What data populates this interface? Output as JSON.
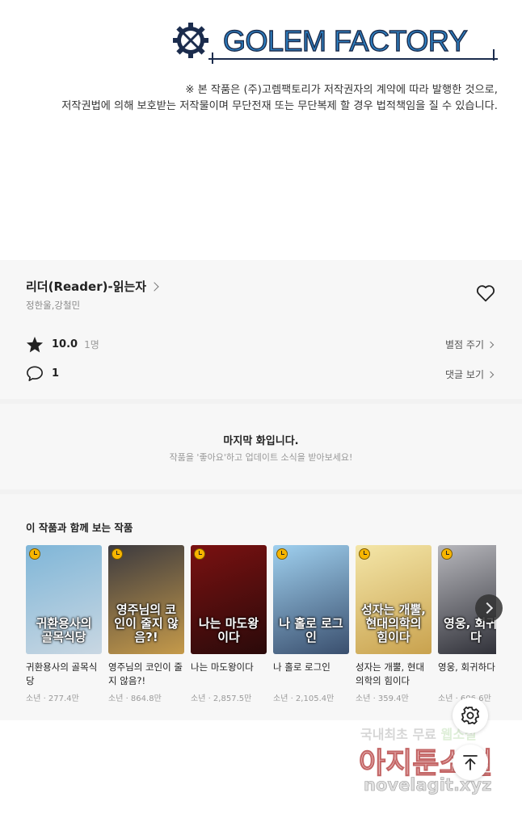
{
  "banner": {
    "logo_text": "GOLEM FACTORY",
    "notice_line1": "※ 본 작품은 (주)고렘팩토리가 저작권자의 계약에 따라 발행한 것으로,",
    "notice_line2": "저작권법에 의해 보호받는 저작물이며 무단전재 또는 무단복제 할 경우 법적책임을 질 수 있습니다."
  },
  "work": {
    "title": "리더(Reader)-읽는자",
    "authors": "정한울,강철민",
    "rating": "10.0",
    "rating_count": "1명",
    "comments": "1",
    "rate_link": "별점 주기",
    "comments_link": "댓글 보기"
  },
  "last_episode": {
    "title": "마지막 화입니다.",
    "subtitle": "작품을 '좋아요'하고 업데이트 소식을 받아보세요!"
  },
  "recommendations": {
    "heading": "이 작품과 함께 보는 작품",
    "items": [
      {
        "name": "귀환용사의 골목식당",
        "meta": "소년 · 277.4만",
        "cover_text": "귀환용사의 골목식당",
        "c1": "#7fb6d8",
        "c2": "#c9d7e2"
      },
      {
        "name": "영주님의 코인이 줄지 않음?!",
        "meta": "소년 · 864.8만",
        "cover_text": "영주님의 코인이 줄지 않음?!",
        "c1": "#3c3a3f",
        "c2": "#c59a4a"
      },
      {
        "name": "나는 마도왕이다",
        "meta": "소년 · 2,857.5만",
        "cover_text": "나는 마도왕이다",
        "c1": "#7a1111",
        "c2": "#2a0a0a"
      },
      {
        "name": "나 홀로 로그인",
        "meta": "소년 · 2,105.4만",
        "cover_text": "나 홀로 로그인",
        "c1": "#9fd0ef",
        "c2": "#3a4f6e"
      },
      {
        "name": "성자는 개뿔, 현대의학의 힘이다",
        "meta": "소년 · 359.4만",
        "cover_text": "성자는 개뿔, 현대의학의 힘이다",
        "c1": "#f4e6a8",
        "c2": "#c9a24e"
      },
      {
        "name": "영웅, 회귀하다",
        "meta": "소년 · 606.6만",
        "cover_text": "영웅, 회귀하다",
        "c1": "#b7b7bc",
        "c2": "#2a2b33"
      }
    ]
  },
  "watermark": {
    "line1_a": "국내최초 무료 ",
    "line1_b": "웹소설",
    "line2": "아지툰소설",
    "line3": "novelagit.xyz"
  },
  "colors": {
    "logo_blue": "#2d7fc1",
    "logo_navy": "#1b2c4d",
    "badge_yellow": "#f7b500"
  },
  "icons": [
    "gear-logo-icon",
    "chevron-right-icon",
    "heart-icon",
    "star-icon",
    "comment-icon",
    "clock-badge-icon",
    "chevron-right-icon",
    "settings-gear-icon",
    "arrow-up-icon"
  ]
}
